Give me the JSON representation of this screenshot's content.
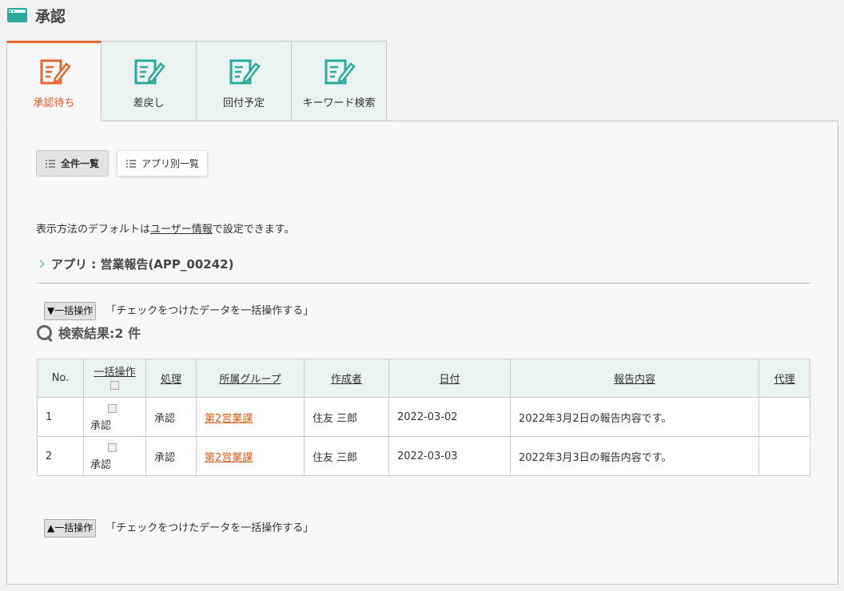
{
  "header": {
    "title": "承認",
    "icon": "window-icon",
    "accent": "#2ba99d"
  },
  "tabs": [
    {
      "label": "承認待ち",
      "active": true
    },
    {
      "label": "差戻し",
      "active": false
    },
    {
      "label": "回付予定",
      "active": false
    },
    {
      "label": "キーワード検索",
      "active": false
    }
  ],
  "view_buttons": {
    "all_label": "全件一覧",
    "by_app_label": "アプリ別一覧"
  },
  "notice": {
    "prefix": "表示方法のデフォルトは",
    "link": "ユーザー情報",
    "suffix": "で設定できます。"
  },
  "app_heading": "アプリ : 営業報告(APP_00242)",
  "bulk_top": {
    "button": "▼一括操作",
    "desc": "「チェックをつけたデータを一括操作する」"
  },
  "bulk_bottom": {
    "button": "▲一括操作",
    "desc": "「チェックをつけたデータを一括操作する」"
  },
  "result_label": "検索結果:2 件",
  "table": {
    "headers": {
      "no": "No.",
      "bulk": "一括操作",
      "action": "処理",
      "group": "所属グループ",
      "author": "作成者",
      "date": "日付",
      "content": "報告内容",
      "proxy": "代理"
    },
    "rows": [
      {
        "no": "1",
        "check_label": "承認",
        "action": "承認",
        "group": "第2営業課",
        "author": "住友 三郎",
        "date": "2022-03-02",
        "content": "2022年3月2日の報告内容です。",
        "proxy": ""
      },
      {
        "no": "2",
        "check_label": "承認",
        "action": "承認",
        "group": "第2営業課",
        "author": "住友 三郎",
        "date": "2022-03-03",
        "content": "2022年3月3日の報告内容です。",
        "proxy": ""
      }
    ]
  },
  "colors": {
    "tab_active": "#e2692f",
    "link": "#d0601f",
    "tab_bg": "#e9f3f2"
  }
}
